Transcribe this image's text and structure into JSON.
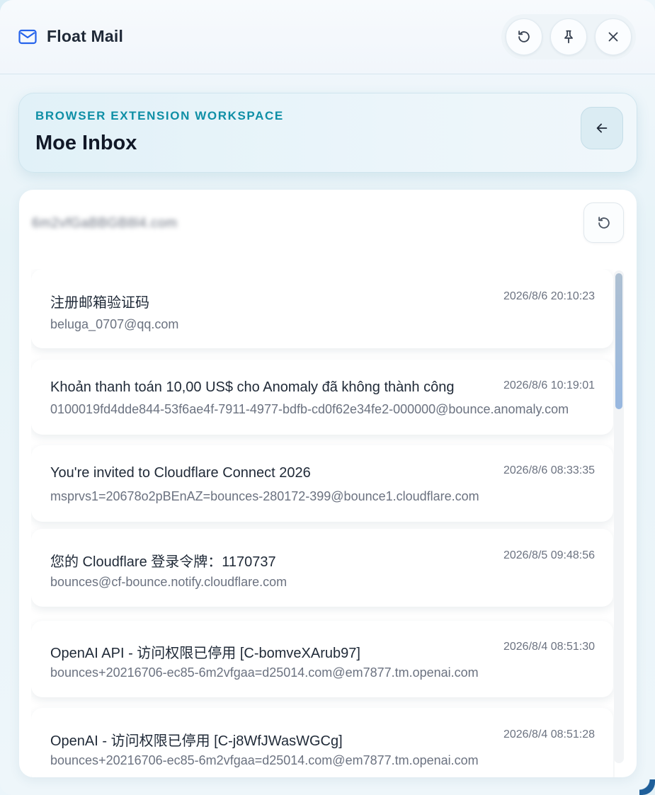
{
  "window": {
    "title": "Float Mail"
  },
  "titlebar_actions": [
    {
      "name": "reload-window-button",
      "icon": "reload-icon"
    },
    {
      "name": "pin-button",
      "icon": "pin-icon"
    },
    {
      "name": "close-button",
      "icon": "close-icon"
    }
  ],
  "header": {
    "eyebrow": "BROWSER EXTENSION WORKSPACE",
    "title": "Moe Inbox",
    "back_icon": "arrow-left-icon"
  },
  "mailbox": {
    "address": "6m2vfGaBBGB8l4.com",
    "refresh_icon": "refresh-icon"
  },
  "messages": [
    {
      "subject": "注册邮箱验证码",
      "time": "2026/8/6 20:10:23",
      "from": "beluga_0707@qq.com"
    },
    {
      "subject": "Khoản thanh toán 10,00 US$ cho Anomaly đã không thành công",
      "time": "2026/8/6 10:19:01",
      "from": "0100019fd4dde844-53f6ae4f-7911-4977-bdfb-cd0f62e34fe2-000000@bounce.anomaly.com"
    },
    {
      "subject": "You're invited to Cloudflare Connect 2026",
      "time": "2026/8/6 08:33:35",
      "from": "msprvs1=20678o2pBEnAZ=bounces-280172-399@bounce1.cloudflare.com"
    },
    {
      "subject": "您的 Cloudflare 登录令牌：1170737",
      "time": "2026/8/5 09:48:56",
      "from": "bounces@cf-bounce.notify.cloudflare.com"
    },
    {
      "subject": "OpenAI API - 访问权限已停用 [C-bomveXArub97]",
      "time": "2026/8/4 08:51:30",
      "from": "bounces+20216706-ec85-6m2vfgaa=d25014.com@em7877.tm.openai.com"
    },
    {
      "subject": "OpenAI - 访问权限已停用 [C-j8WfJWasWGCg]",
      "time": "2026/8/4 08:51:28",
      "from": "bounces+20216706-ec85-6m2vfgaa=d25014.com@em7877.tm.openai.com"
    }
  ],
  "colors": {
    "accent": "#0f8fa6",
    "title_text": "#1f2937",
    "muted_text": "#6b7280",
    "scroll_thumb": "#98b8e0"
  }
}
